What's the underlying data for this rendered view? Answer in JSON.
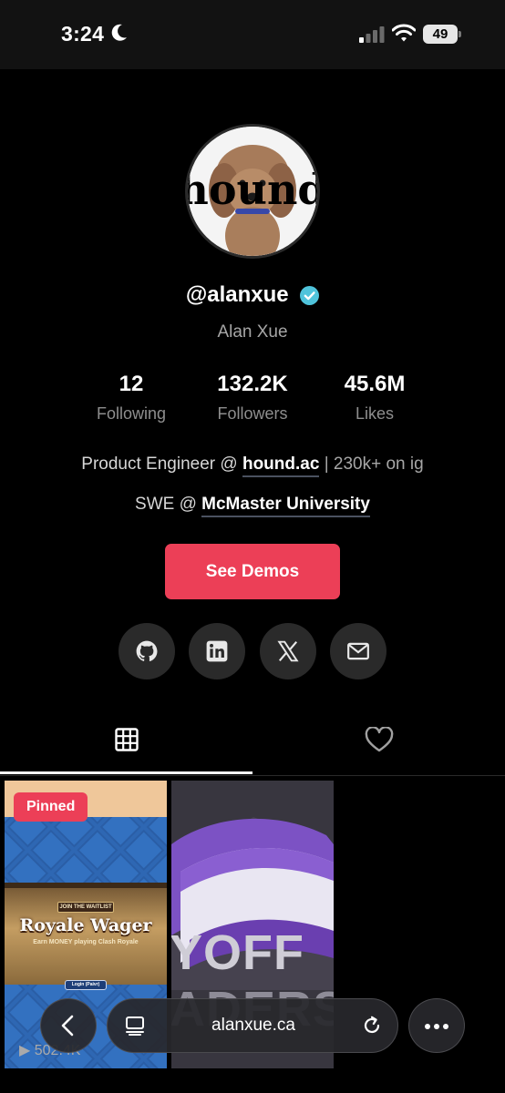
{
  "status_bar": {
    "time": "3:24",
    "battery": "49"
  },
  "profile": {
    "handle": "@alanxue",
    "display_name": "Alan Xue",
    "avatar_text": "hound",
    "stats": [
      {
        "value": "12",
        "label": "Following"
      },
      {
        "value": "132.2K",
        "label": "Followers"
      },
      {
        "value": "45.6M",
        "label": "Likes"
      }
    ],
    "bio": {
      "line1_prefix": "Product Engineer @ ",
      "line1_link": "hound.ac",
      "line1_suffix": " | 230k+ on ig",
      "line2_prefix": "SWE @ ",
      "line2_link": "McMaster University"
    },
    "cta_label": "See Demos",
    "social_links": [
      "github-icon",
      "linkedin-icon",
      "x-icon",
      "mail-icon"
    ]
  },
  "tabs": [
    {
      "icon": "grid-icon",
      "active": true
    },
    {
      "icon": "heart-icon",
      "active": false
    }
  ],
  "videos": [
    {
      "badge": "Pinned",
      "waitlist": "JOIN THE WAITLIST",
      "title": "Royale Wager",
      "subtitle": "Earn MONEY playing Clash Royale",
      "button": "Login (Paivr)",
      "views": "▶ 502.4K"
    },
    {
      "title_top": "YOFF",
      "title_bottom": "ADERS"
    }
  ],
  "browser": {
    "url": "alanxue.ca"
  },
  "colors": {
    "accent": "#ec3f57",
    "verified": "#4fc3db",
    "background": "#000000"
  }
}
